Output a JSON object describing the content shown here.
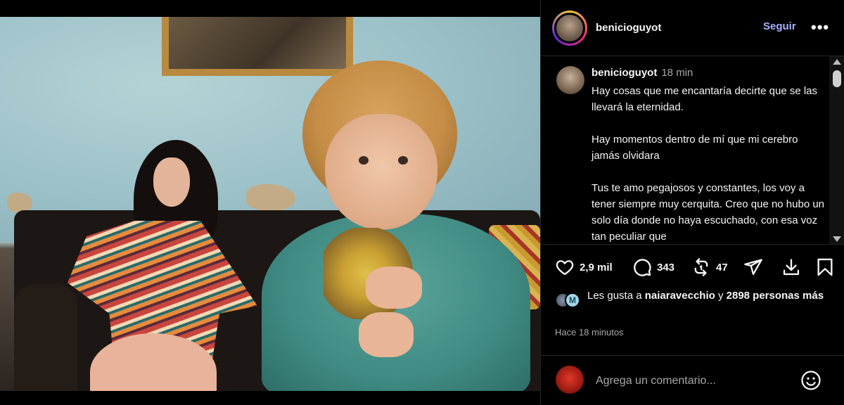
{
  "post": {
    "username": "benicioguyot",
    "follow_label": "Seguir",
    "more_label": "•••"
  },
  "caption": {
    "username": "benicioguyot",
    "time": "18 min",
    "text": "Hay cosas que me encantaría decirte que se las llevará la eternidad.\n\nHay momentos dentro de mí que mi cerebro jamás olvidara\n\nTus te amo pegajosos y constantes, los voy a tener siempre muy cerquita. Creo que no hubo un solo día donde no haya escuchado, con esa voz tan peculiar que"
  },
  "actions": {
    "likes_count": "2,9 mil",
    "comments_count": "343",
    "reposts_count": "47",
    "icons": [
      "heart-icon",
      "comment-icon",
      "repost-icon",
      "share-icon",
      "download-icon",
      "save-icon"
    ]
  },
  "likes": {
    "prefix": "Les gusta a",
    "user": "naiaravecchio",
    "connector": "y",
    "others": "2898 personas más"
  },
  "time_ago": "Hace 18 minutos",
  "comment": {
    "placeholder": "Agrega un comentario..."
  },
  "colors": {
    "background": "#000000",
    "text": "#f5f5f5",
    "muted": "#a8a8a8",
    "follow": "#a8b2ff",
    "divider": "#262626"
  }
}
